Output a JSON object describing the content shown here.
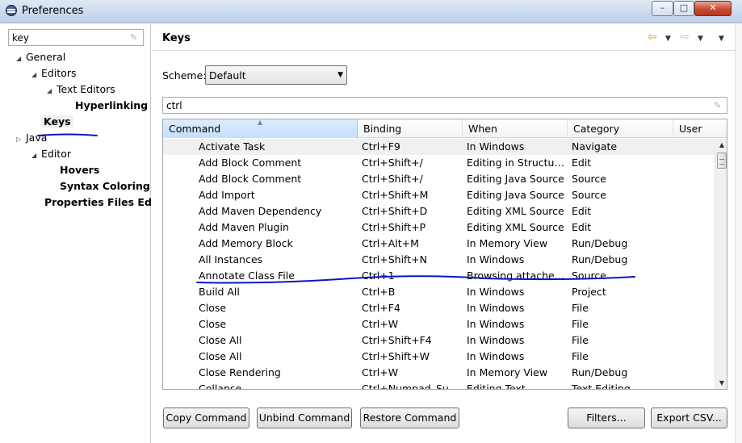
{
  "window": {
    "title": "Preferences",
    "icon": "eclipse-icon",
    "controls": {
      "minimize": "–",
      "maximize": "□",
      "close": "✕"
    }
  },
  "left": {
    "filter_value": "key",
    "tree": [
      {
        "label": "General",
        "arrow": "◢"
      },
      {
        "label": "Editors",
        "arrow": "◢"
      },
      {
        "label": "Text Editors",
        "arrow": "◢"
      },
      {
        "label": "Hyperlinking",
        "arrow": ""
      },
      {
        "label": "Keys",
        "arrow": ""
      },
      {
        "label": "Java",
        "arrow": "▷"
      },
      {
        "label": "Editor",
        "arrow": "◢"
      },
      {
        "label": "Hovers",
        "arrow": ""
      },
      {
        "label": "Syntax Coloring",
        "arrow": ""
      },
      {
        "label": "Properties Files Edit",
        "arrow": ""
      }
    ]
  },
  "page": {
    "title": "Keys",
    "scheme_label": "Scheme:",
    "scheme_value": "Default",
    "filter_value": "ctrl"
  },
  "table": {
    "columns": [
      "Command",
      "Binding",
      "When",
      "Category",
      "User"
    ],
    "rows": [
      [
        "Activate Task",
        "Ctrl+F9",
        "In Windows",
        "Navigate"
      ],
      [
        "Add Block Comment",
        "Ctrl+Shift+/",
        "Editing in Structure...",
        "Edit"
      ],
      [
        "Add Block Comment",
        "Ctrl+Shift+/",
        "Editing Java Source",
        "Source"
      ],
      [
        "Add Import",
        "Ctrl+Shift+M",
        "Editing Java Source",
        "Source"
      ],
      [
        "Add Maven Dependency",
        "Ctrl+Shift+D",
        "Editing XML Source",
        "Edit"
      ],
      [
        "Add Maven Plugin",
        "Ctrl+Shift+P",
        "Editing XML Source",
        "Edit"
      ],
      [
        "Add Memory Block",
        "Ctrl+Alt+M",
        "In Memory View",
        "Run/Debug"
      ],
      [
        "All Instances",
        "Ctrl+Shift+N",
        "In Windows",
        "Run/Debug"
      ],
      [
        "Annotate Class File",
        "Ctrl+1",
        "Browsing attached ...",
        "Source"
      ],
      [
        "Build All",
        "Ctrl+B",
        "In Windows",
        "Project"
      ],
      [
        "Close",
        "Ctrl+F4",
        "In Windows",
        "File"
      ],
      [
        "Close",
        "Ctrl+W",
        "In Windows",
        "File"
      ],
      [
        "Close All",
        "Ctrl+Shift+F4",
        "In Windows",
        "File"
      ],
      [
        "Close All",
        "Ctrl+Shift+W",
        "In Windows",
        "File"
      ],
      [
        "Close Rendering",
        "Ctrl+W",
        "In Memory View",
        "Run/Debug"
      ],
      [
        "Collapse",
        "Ctrl+Numpad_Subt...",
        "Editing Text",
        "Text Editing"
      ]
    ]
  },
  "buttons": {
    "copy": "Copy Command",
    "unbind": "Unbind Command",
    "restore": "Restore Command",
    "filters": "Filters...",
    "export": "Export CSV..."
  },
  "colors": {
    "ink": "#0a16c8"
  }
}
